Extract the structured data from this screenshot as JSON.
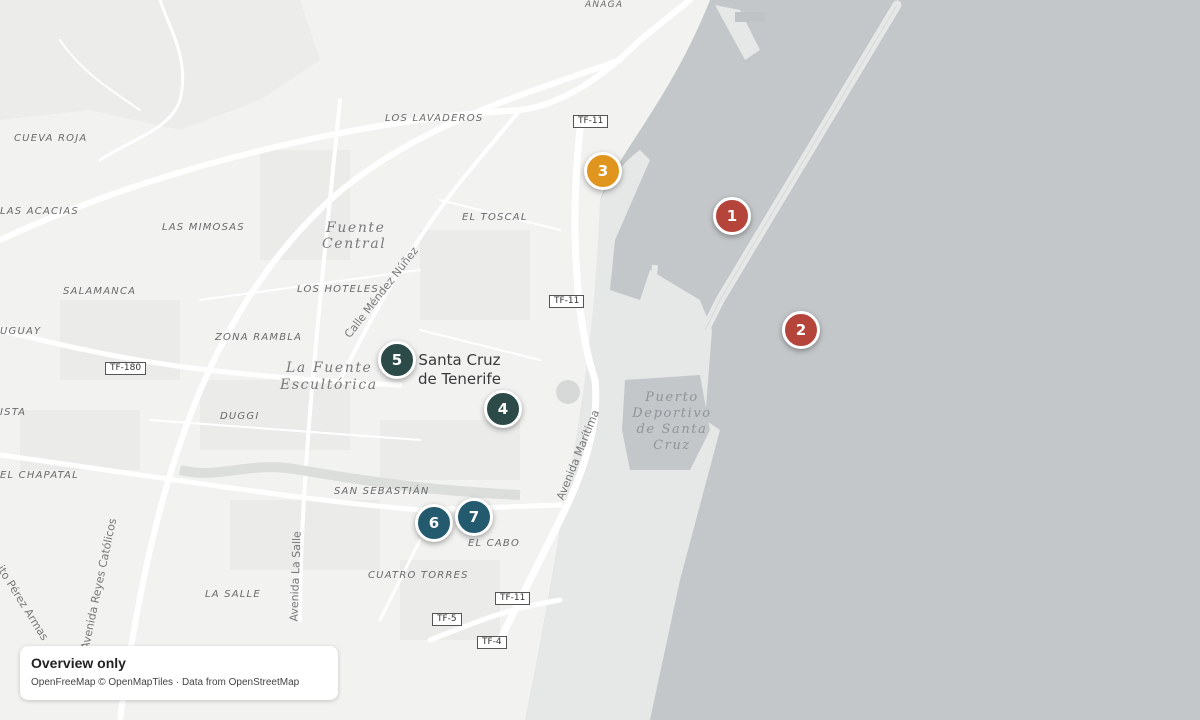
{
  "map": {
    "place_labels": [
      {
        "id": "los-lavaderos",
        "text": "LOS LAVADEROS"
      },
      {
        "id": "cueva-roja",
        "text": "CUEVA ROJA"
      },
      {
        "id": "las-acacias",
        "text": "LAS ACACIAS"
      },
      {
        "id": "las-mimosas",
        "text": "LAS MIMOSAS"
      },
      {
        "id": "el-toscal",
        "text": "EL TOSCAL"
      },
      {
        "id": "los-hoteles",
        "text": "LOS HOTELES"
      },
      {
        "id": "salamanca",
        "text": "SALAMANCA"
      },
      {
        "id": "zona-rambla",
        "text": "ZONA RAMBLA"
      },
      {
        "id": "uguay",
        "text": "UGUAY"
      },
      {
        "id": "duggi",
        "text": "DUGGI"
      },
      {
        "id": "ista",
        "text": "ISTA"
      },
      {
        "id": "el-chapatal",
        "text": "EL CHAPATAL"
      },
      {
        "id": "san-sebastian",
        "text": "SAN SEBASTIÁN"
      },
      {
        "id": "el-cabo",
        "text": "EL CABO"
      },
      {
        "id": "cuatro-torres",
        "text": "CUATRO TORRES"
      },
      {
        "id": "la-salle",
        "text": "LA SALLE"
      },
      {
        "id": "anaga",
        "text": "ANAGA"
      }
    ],
    "large_labels": {
      "fuente_central": [
        "Fuente",
        "Central"
      ],
      "la_fuente_escultorica": [
        "La Fuente",
        "Escultórica"
      ]
    },
    "city": [
      "Santa Cruz",
      "de Tenerife"
    ],
    "harbor": [
      "Puerto",
      "Deportivo",
      "de Santa",
      "Cruz"
    ],
    "streets": {
      "mendez_nunez": "Calle Méndez Núñez",
      "maritima": "Avenida Marítima",
      "reyes_catolicos": "Avenida Reyes Católicos",
      "la_salle": "Avenida La Salle",
      "perez_armas": "ito Pérez Armas"
    },
    "shields": {
      "tf11_top": "TF-11",
      "tf11_mid": "TF-11",
      "tf180": "TF-180",
      "tf11_bottom": "TF-11",
      "tf5": "TF-5",
      "tf4": "TF-4"
    },
    "markers": [
      {
        "label": "1",
        "color": "#b5443a"
      },
      {
        "label": "2",
        "color": "#b5443a"
      },
      {
        "label": "3",
        "color": "#e0961e"
      },
      {
        "label": "4",
        "color": "#2c4a48"
      },
      {
        "label": "5",
        "color": "#2c4a48"
      },
      {
        "label": "6",
        "color": "#235a6e"
      },
      {
        "label": "7",
        "color": "#235a6e"
      }
    ]
  },
  "panel": {
    "title": "Overview only",
    "attribution": "OpenFreeMap © OpenMapTiles · Data from OpenStreetMap"
  },
  "colors": {
    "sea": "#c3c7c9",
    "land": "#f2f2f1",
    "road": "#ffffff",
    "dock": "#e6e7e7"
  }
}
